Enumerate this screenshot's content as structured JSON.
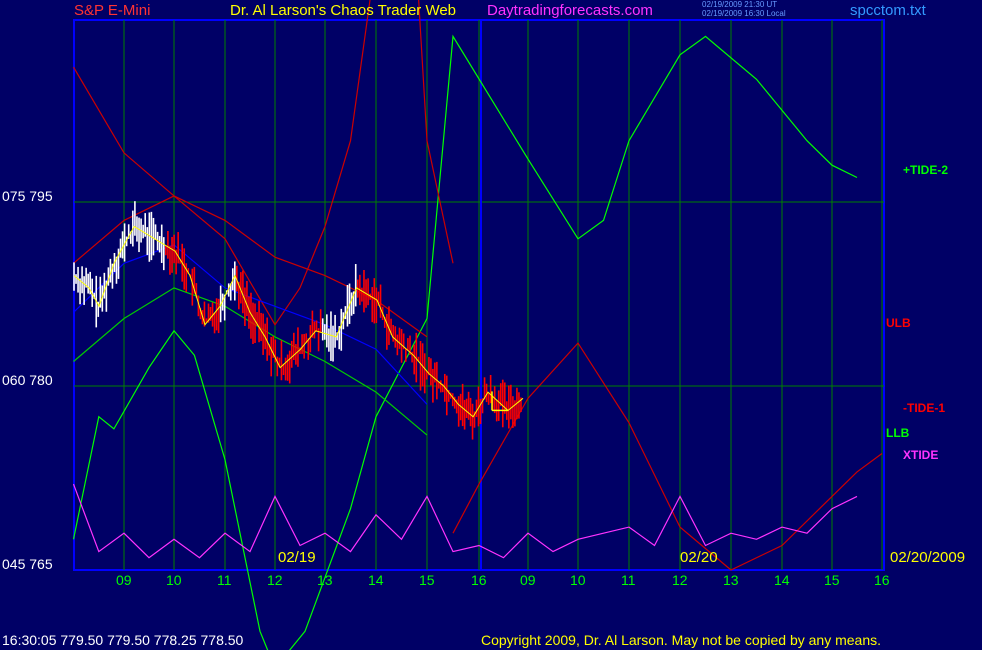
{
  "header": {
    "symbol": "S&P E-Mini",
    "title": "Dr. Al Larson's Chaos Trader Web",
    "site": "Daytradingforecasts.com",
    "time_ut": "02/19/2009 21:30 UT",
    "time_local": "02/19/2009 16:30 Local",
    "file": "spcctom.txt"
  },
  "footer": {
    "quote": "16:30:05  779.50 779.50 778.25 778.50",
    "copyright": "Copyright 2009, Dr. Al Larson. May not be copied by any means."
  },
  "colors": {
    "background": "#000066",
    "grid": "#008000",
    "price_up": "#ffffff",
    "price_down": "#ff0000",
    "tide2": "#00ff00",
    "tide1": "#ff0000",
    "xtide": "#ff33ff",
    "ulb": "#cc0000",
    "llb": "#00cc00",
    "moving_avg_blue": "#0000ff",
    "moving_avg_yellow": "#ffff00",
    "date_labels": "#ffff00",
    "divider": "#0000ff"
  },
  "chart_data": {
    "type": "line",
    "title": "S&P E-Mini",
    "y_left_labels": [
      {
        "value": 795,
        "text": "075  795"
      },
      {
        "value": 780,
        "text": "060  780"
      },
      {
        "value": 765,
        "text": "045  765"
      }
    ],
    "ylim": [
      765,
      795
    ],
    "x_hour_ticks": [
      "09",
      "10",
      "11",
      "12",
      "13",
      "14",
      "15",
      "16",
      "09",
      "10",
      "11",
      "12",
      "13",
      "14",
      "15",
      "16"
    ],
    "date_labels": [
      "02/19",
      "02/20",
      "02/20/2009"
    ],
    "grid": true,
    "legend": [
      {
        "name": "+TIDE-2",
        "color": "#00ff00"
      },
      {
        "name": "ULB",
        "color": "#ff0000"
      },
      {
        "name": "-TIDE-1",
        "color": "#ff0000"
      },
      {
        "name": "LLB",
        "color": "#00ff00"
      },
      {
        "name": "XTIDE",
        "color": "#ff33ff"
      }
    ],
    "last_close": 778.5,
    "series": [
      {
        "name": "+TIDE-2",
        "color": "#00ff00",
        "points": [
          [
            0,
            767.5
          ],
          [
            0.5,
            777.5
          ],
          [
            0.8,
            776.5
          ],
          [
            1.5,
            781.5
          ],
          [
            2,
            784.5
          ],
          [
            2.4,
            782.5
          ],
          [
            3,
            774
          ],
          [
            3.7,
            760
          ],
          [
            4,
            757
          ],
          [
            4.6,
            760
          ],
          [
            5.5,
            770
          ],
          [
            6,
            777.5
          ],
          [
            7,
            785.5
          ],
          [
            7.5,
            808.5
          ],
          [
            9,
            798.5
          ],
          [
            10,
            792
          ],
          [
            10.5,
            793.5
          ],
          [
            11,
            800
          ],
          [
            12,
            807
          ],
          [
            12.5,
            808.5
          ],
          [
            13.5,
            805
          ],
          [
            14.5,
            800
          ],
          [
            15,
            798
          ],
          [
            15.5,
            797
          ]
        ]
      },
      {
        "name": "-TIDE-1",
        "color": "#cc0000",
        "points": [
          [
            7.5,
            768
          ],
          [
            8,
            772
          ],
          [
            9,
            779
          ],
          [
            10,
            783.5
          ],
          [
            11,
            777
          ],
          [
            12,
            768.5
          ],
          [
            13,
            765
          ],
          [
            14,
            767
          ],
          [
            15,
            771
          ],
          [
            15.5,
            773
          ],
          [
            16,
            774.5
          ]
        ]
      },
      {
        "name": "ULB",
        "color": "#cc0000",
        "points": [
          [
            0,
            806
          ],
          [
            1,
            799
          ],
          [
            2,
            795.5
          ],
          [
            3,
            792
          ],
          [
            4,
            785
          ],
          [
            4.5,
            788
          ],
          [
            5,
            793
          ],
          [
            5.5,
            800
          ],
          [
            6,
            815
          ],
          [
            6.5,
            835
          ],
          [
            7,
            800
          ],
          [
            7.5,
            790
          ]
        ]
      },
      {
        "name": "LLB",
        "color": "#00cc00",
        "points": [
          [
            0,
            782
          ],
          [
            1,
            785.5
          ],
          [
            2,
            788
          ],
          [
            3,
            786.5
          ],
          [
            4,
            784
          ],
          [
            5,
            782
          ],
          [
            6,
            779.5
          ],
          [
            7,
            776
          ]
        ]
      },
      {
        "name": "MA-Blue",
        "color": "#0000ff",
        "points": [
          [
            0,
            786
          ],
          [
            1,
            790
          ],
          [
            2,
            791.5
          ],
          [
            3,
            788
          ],
          [
            4,
            786.5
          ],
          [
            5,
            785
          ],
          [
            6,
            783
          ],
          [
            7,
            778.5
          ]
        ]
      },
      {
        "name": "Upper-Red-2",
        "color": "#cc0000",
        "points": [
          [
            0,
            790
          ],
          [
            1,
            793.5
          ],
          [
            2,
            795.5
          ],
          [
            3,
            793.5
          ],
          [
            4,
            790.5
          ],
          [
            5,
            789
          ],
          [
            6,
            787
          ],
          [
            7,
            784
          ]
        ]
      },
      {
        "name": "XTIDE",
        "color": "#ff33ff",
        "scale": "pixel-offset",
        "points": [
          [
            0,
            772
          ],
          [
            0.5,
            766.5
          ],
          [
            1,
            768
          ],
          [
            1.5,
            766
          ],
          [
            2,
            767.5
          ],
          [
            2.5,
            766
          ],
          [
            3,
            768
          ],
          [
            3.5,
            766.5
          ],
          [
            4,
            771
          ],
          [
            4.5,
            767
          ],
          [
            5,
            768
          ],
          [
            5.5,
            766.5
          ],
          [
            6,
            769.5
          ],
          [
            6.5,
            767.5
          ],
          [
            7,
            771
          ],
          [
            7.5,
            766.5
          ],
          [
            8,
            767
          ],
          [
            8.5,
            766
          ],
          [
            9,
            768
          ],
          [
            9.5,
            766.5
          ],
          [
            10,
            767.5
          ],
          [
            10.5,
            768
          ],
          [
            11,
            768.5
          ],
          [
            11.5,
            767
          ],
          [
            12,
            771
          ],
          [
            12.5,
            767
          ],
          [
            13,
            768
          ],
          [
            13.5,
            767.5
          ],
          [
            14,
            768.5
          ],
          [
            14.5,
            768
          ],
          [
            15,
            770
          ],
          [
            15.5,
            771
          ]
        ]
      }
    ],
    "price_segments": [
      {
        "from_hour": 0,
        "to_hour": 7,
        "high": 792.5,
        "low": 776.5
      }
    ]
  }
}
